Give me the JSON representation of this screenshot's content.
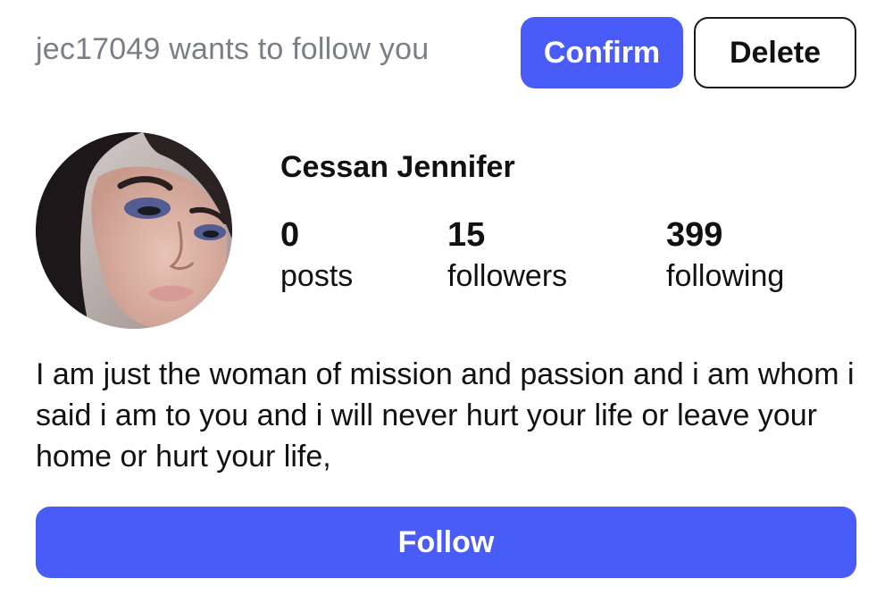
{
  "request": {
    "text": "jec17049 wants to follow you",
    "confirm_label": "Confirm",
    "delete_label": "Delete"
  },
  "profile": {
    "name": "Cessan Jennifer",
    "stats": {
      "posts": {
        "value": "0",
        "label": "posts"
      },
      "followers": {
        "value": "15",
        "label": "followers"
      },
      "following": {
        "value": "399",
        "label": "following"
      }
    },
    "bio": "I am just the woman of mission and passion and i am whom i said i am to you and i will never hurt your life or leave your home or hurt your life,",
    "follow_label": "Follow"
  },
  "colors": {
    "accent": "#4a5cf7",
    "muted_text": "#7a7f87",
    "text": "#111111"
  }
}
